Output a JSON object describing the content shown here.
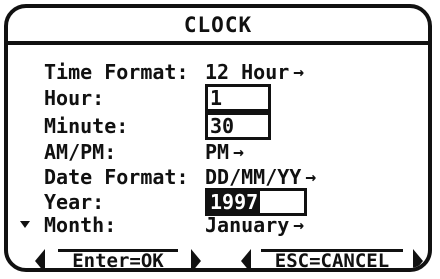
{
  "dialog": {
    "title": "CLOCK"
  },
  "fields": {
    "time_format": {
      "label": "Time Format:",
      "value": "12 Hour"
    },
    "hour": {
      "label": "Hour:",
      "value": "1"
    },
    "minute": {
      "label": "Minute:",
      "value": "30"
    },
    "ampm": {
      "label": "AM/PM:",
      "value": "PM"
    },
    "date_format": {
      "label": "Date Format:",
      "value": "DD/MM/YY"
    },
    "year": {
      "label": "Year:",
      "value": "1997"
    },
    "month": {
      "label": "Month:",
      "value": "January"
    }
  },
  "icons": {
    "dropdown_arrow": "→",
    "scroll_down": "▼"
  },
  "buttons": {
    "ok": "Enter=OK",
    "cancel": "ESC=CANCEL"
  }
}
